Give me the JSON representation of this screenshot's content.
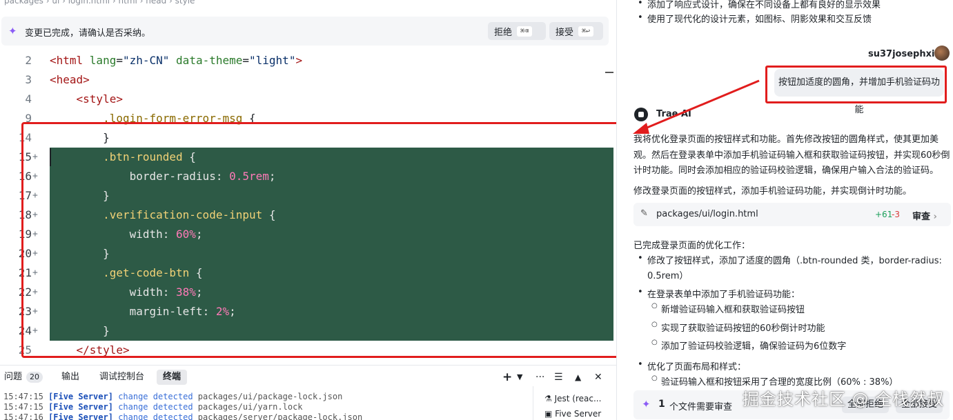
{
  "breadcrumb": "packages › ui › login.html › html › head › style",
  "change_bar": {
    "message": "变更已完成，请确认是否采纳。",
    "reject_label": "拒绝",
    "reject_shortcut": "⌘⌫",
    "accept_label": "接受",
    "accept_shortcut": "⌘↩"
  },
  "code_lines": [
    {
      "num": "2",
      "added": false,
      "tokens": [
        [
          "t-tag",
          "<html "
        ],
        [
          "t-attr",
          "lang"
        ],
        [
          "t-pun",
          "="
        ],
        [
          "t-str",
          "\"zh-CN\""
        ],
        [
          "t-pun",
          " "
        ],
        [
          "t-attr",
          "data-theme"
        ],
        [
          "t-pun",
          "="
        ],
        [
          "t-str",
          "\"light\""
        ],
        [
          "t-tag",
          ">"
        ]
      ]
    },
    {
      "num": "3",
      "added": false,
      "tokens": [
        [
          "t-tag",
          "<head>"
        ]
      ]
    },
    {
      "num": "4",
      "added": false,
      "tokens": [
        [
          "t-pun",
          "    "
        ],
        [
          "t-tag",
          "<style>"
        ]
      ]
    },
    {
      "num": "9",
      "added": false,
      "tokens": [
        [
          "t-pun",
          "        "
        ],
        [
          "t-sel",
          ".login-form-error-msg "
        ],
        [
          "t-pun",
          "{"
        ]
      ]
    },
    {
      "num": "14",
      "added": false,
      "tokens": [
        [
          "t-pun",
          "        }"
        ]
      ]
    },
    {
      "num": "15",
      "added": true,
      "tokens": [
        [
          "t-pun",
          "        "
        ],
        [
          "t-sel",
          ".btn-rounded "
        ],
        [
          "t-pun",
          "{"
        ]
      ]
    },
    {
      "num": "16",
      "added": true,
      "tokens": [
        [
          "t-pun",
          "            "
        ],
        [
          "t-prop",
          "border-radius"
        ],
        [
          "t-pun",
          ": "
        ],
        [
          "t-num",
          "0.5rem"
        ],
        [
          "t-pun",
          ";"
        ]
      ]
    },
    {
      "num": "17",
      "added": true,
      "tokens": [
        [
          "t-pun",
          "        }"
        ]
      ]
    },
    {
      "num": "18",
      "added": true,
      "tokens": [
        [
          "t-pun",
          "        "
        ],
        [
          "t-sel",
          ".verification-code-input "
        ],
        [
          "t-pun",
          "{"
        ]
      ]
    },
    {
      "num": "19",
      "added": true,
      "tokens": [
        [
          "t-pun",
          "            "
        ],
        [
          "t-prop",
          "width"
        ],
        [
          "t-pun",
          ": "
        ],
        [
          "t-num",
          "60%"
        ],
        [
          "t-pun",
          ";"
        ]
      ]
    },
    {
      "num": "20",
      "added": true,
      "tokens": [
        [
          "t-pun",
          "        }"
        ]
      ]
    },
    {
      "num": "21",
      "added": true,
      "tokens": [
        [
          "t-pun",
          "        "
        ],
        [
          "t-sel",
          ".get-code-btn "
        ],
        [
          "t-pun",
          "{"
        ]
      ]
    },
    {
      "num": "22",
      "added": true,
      "tokens": [
        [
          "t-pun",
          "            "
        ],
        [
          "t-prop",
          "width"
        ],
        [
          "t-pun",
          ": "
        ],
        [
          "t-num",
          "38%"
        ],
        [
          "t-pun",
          ";"
        ]
      ]
    },
    {
      "num": "23",
      "added": true,
      "tokens": [
        [
          "t-pun",
          "            "
        ],
        [
          "t-prop",
          "margin-left"
        ],
        [
          "t-pun",
          ": "
        ],
        [
          "t-num",
          "2%"
        ],
        [
          "t-pun",
          ";"
        ]
      ]
    },
    {
      "num": "24",
      "added": true,
      "tokens": [
        [
          "t-pun",
          "        }"
        ]
      ]
    },
    {
      "num": "25",
      "added": false,
      "tokens": [
        [
          "t-pun",
          "    "
        ],
        [
          "t-tag",
          "</style>"
        ]
      ]
    }
  ],
  "panel": {
    "tabs": {
      "problems": "问题",
      "problems_count": "20",
      "output": "输出",
      "debug": "调试控制台",
      "terminal": "终端"
    },
    "logs": [
      {
        "time": "15:47:15",
        "tag": "[Five Server]",
        "action": "change detected",
        "path": "packages/ui/package-lock.json"
      },
      {
        "time": "15:47:15",
        "tag": "[Five Server]",
        "action": "change detected",
        "path": "packages/ui/yarn.lock"
      },
      {
        "time": "15:47:16",
        "tag": "[Five Server]",
        "action": "change detected",
        "path": "packages/server/package-lock.json"
      }
    ],
    "terminals": [
      "Jest (reac...",
      "Five Server"
    ]
  },
  "chat": {
    "top_bullets": [
      "添加了响应式设计，确保在不同设备上都有良好的显示效果",
      "使用了现代化的设计元素，如图标、阴影效果和交互反馈"
    ],
    "user_name": "su37josephxia",
    "user_message": "按钮加适度的圆角，并增加手机验证码功能",
    "ai_name": "Trae AI",
    "ai_paragraph": [
      "我将优化登录页面的按钮样式和功能。首先修改按钮的圆角样式，使其更加美",
      "观。然后在登录表单中添加手机验证码输入框和获取验证码按钮，并实现60秒倒",
      "计时功能。同时会添加相应的验证码校验逻辑，确保用户输入合法的验证码。"
    ],
    "ai_summary": "修改登录页面的按钮样式，添加手机验证码功能，并实现倒计时功能。",
    "file": {
      "name": "packages/ui/login.html",
      "added": "+61",
      "removed": "-3",
      "review": "审查"
    },
    "done_title": "已完成登录页面的优化工作：",
    "bullet1": [
      "修改了按钮样式，添加了适度的圆角（.btn-rounded 类，border-radius:",
      "0.5rem）"
    ],
    "bullet2": "在登录表单中添加了手机验证码功能：",
    "sub_bullets": [
      "新增验证码输入框和获取验证码按钮",
      "实现了获取验证码按钮的60秒倒计时功能",
      "添加了验证码校验逻辑，确保验证码为6位数字"
    ],
    "bullet3": "优化了页面布局和样式：",
    "sub_bullet3": "验证码输入框和按钮采用了合理的宽度比例（60% : 38%）",
    "review_bar": {
      "count": "1",
      "label": "个文件需要审查",
      "reject_all": "全部拒绝",
      "accept_all": "全部接受"
    },
    "watermark": "掘金技术社区 @ 全栈然叔"
  },
  "colors": {
    "accent": "#8b5cf6",
    "added_bg": "#2d5a46",
    "annotation": "#e11d1d"
  }
}
